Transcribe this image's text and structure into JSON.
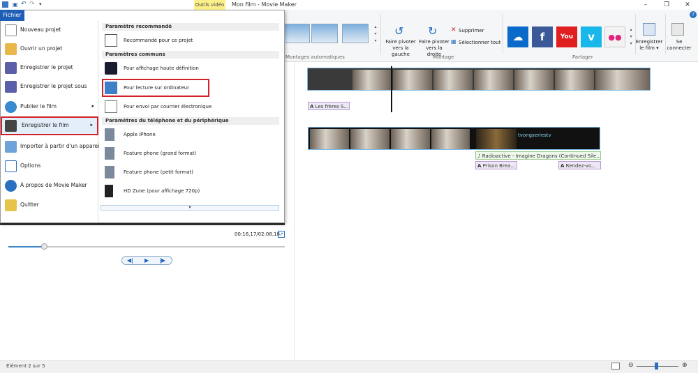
{
  "window": {
    "title": "Mon film - Movie Maker",
    "contextual_tab": "Outils vidéo",
    "controls": [
      "–",
      "❐",
      "✕"
    ],
    "help": "?"
  },
  "file_tab": "Fichier",
  "left_menu": [
    {
      "label": "Nouveau projet",
      "icon": "new-project-icon",
      "arrow": false
    },
    {
      "label": "Ouvrir un projet",
      "icon": "open-folder-icon",
      "arrow": false
    },
    {
      "label": "Enregistrer le projet",
      "icon": "save-icon",
      "arrow": false
    },
    {
      "label": "Enregistrer le projet sous",
      "icon": "save-as-icon",
      "arrow": false
    },
    {
      "label": "Publier le film",
      "icon": "globe-icon",
      "arrow": true
    },
    {
      "label": "Enregistrer le film",
      "icon": "film-save-icon",
      "arrow": true
    },
    {
      "label": "Importer à partir d'un appareil",
      "icon": "import-device-icon",
      "arrow": false
    },
    {
      "label": "Options",
      "icon": "options-icon",
      "arrow": false
    },
    {
      "label": "À propos de Movie Maker",
      "icon": "info-icon",
      "arrow": false
    },
    {
      "label": "Quitter",
      "icon": "exit-icon",
      "arrow": false
    }
  ],
  "right_menu": {
    "recommended_header": "Paramètre recommandé",
    "recommended": [
      {
        "label": "Recommandé pour ce projet",
        "icon": "recommended-icon"
      }
    ],
    "common_header": "Paramètres communs",
    "common": [
      {
        "label": "Pour affichage haute définition",
        "icon": "hd-display-icon"
      },
      {
        "label": "Pour lecture sur ordinateur",
        "icon": "computer-icon"
      },
      {
        "label": "Pour envoi par courrier électronique",
        "icon": "email-icon"
      }
    ],
    "device_header": "Paramètres du téléphone et du périphérique",
    "device": [
      {
        "label": "Apple iPhone",
        "icon": "phone-icon"
      },
      {
        "label": "Feature phone (grand format)",
        "icon": "phone-icon"
      },
      {
        "label": "Feature phone (petit format)",
        "icon": "phone-icon"
      },
      {
        "label": "HD Zune (pour affichage 720p)",
        "icon": "zune-icon"
      }
    ]
  },
  "ribbon": {
    "auto_movies_label": "Montages automatiques",
    "editing_label": "Montage",
    "rotate_left": "Faire pivoter vers la gauche",
    "rotate_right": "Faire pivoter vers la droite",
    "delete": "Supprimer",
    "select_all": "Sélectionner tout",
    "share_label": "Partager",
    "save_movie": "Enregistrer le film ▾",
    "sign_in": "Se connecter",
    "social": [
      {
        "name": "onedrive-icon",
        "color": "#0a6ac9",
        "glyph": "☁"
      },
      {
        "name": "facebook-icon",
        "color": "#3b5998",
        "glyph": "f"
      },
      {
        "name": "youtube-icon",
        "color": "#e02020",
        "glyph": "You"
      },
      {
        "name": "vimeo-icon",
        "color": "#1ab7ea",
        "glyph": "v"
      },
      {
        "name": "flickr-icon",
        "color": "#f2f2f2",
        "glyph": "●●"
      }
    ]
  },
  "preview": {
    "time": "00:16,17/02:08,18"
  },
  "timeline": {
    "caption1": "Les frères S...",
    "music_caption": "Radioactive - Imagine Dragons (Continued Sile...",
    "caption2": "Prison Brea...",
    "caption3": "Rendez-vo...",
    "brand_text": "tvongseriestv"
  },
  "status": {
    "text": "Élément 2 sur 5"
  },
  "colors": {
    "accent": "#1e5fb5",
    "highlight_border": "#d0212b"
  }
}
